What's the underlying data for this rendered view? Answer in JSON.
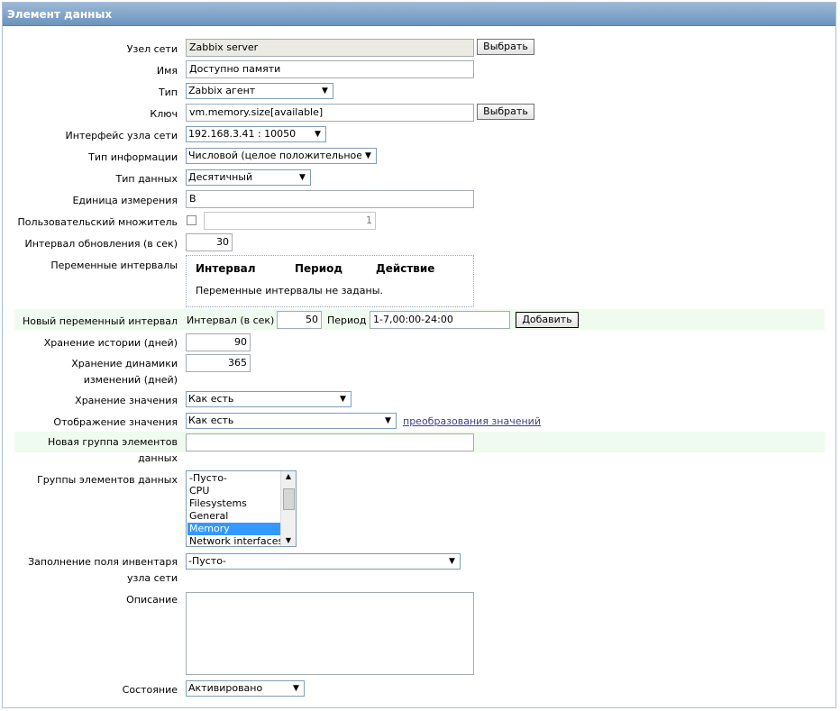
{
  "window": {
    "title": "Элемент данных"
  },
  "form": {
    "host": {
      "label": "Узел сети",
      "value": "Zabbix server",
      "button": "Выбрать"
    },
    "name": {
      "label": "Имя",
      "value": "Доступно памяти"
    },
    "type": {
      "label": "Тип",
      "value": "Zabbix агент"
    },
    "key": {
      "label": "Ключ",
      "value": "vm.memory.size[available]",
      "button": "Выбрать"
    },
    "interface": {
      "label": "Интерфейс узла сети",
      "value": "192.168.3.41 : 10050"
    },
    "info_type": {
      "label": "Тип информации",
      "value": "Числовой (целое положительное)"
    },
    "data_type": {
      "label": "Тип данных",
      "value": "Десятичный"
    },
    "units": {
      "label": "Единица измерения",
      "value": "B"
    },
    "multiplier": {
      "label": "Пользовательский множитель",
      "checked": false,
      "value": "1"
    },
    "update_interval": {
      "label": "Интервал обновления (в сек)",
      "value": "30"
    },
    "flex_intervals": {
      "label": "Переменные интервалы",
      "columns": [
        "Интервал",
        "Период",
        "Действие"
      ],
      "empty_text": "Переменные интервалы не заданы."
    },
    "new_flex": {
      "label": "Новый переменный интервал",
      "interval_label": "Интервал (в сек)",
      "interval_value": "50",
      "period_label": "Период",
      "period_value": "1-7,00:00-24:00",
      "add_button": "Добавить"
    },
    "history": {
      "label": "Хранение истории (дней)",
      "value": "90"
    },
    "trends": {
      "label_line1": "Хранение динамики",
      "label_line2": "изменений (дней)",
      "value": "365"
    },
    "store_value": {
      "label": "Хранение значения",
      "value": "Как есть"
    },
    "show_value": {
      "label": "Отображение значения",
      "value": "Как есть",
      "link": "преобразования значений"
    },
    "new_group": {
      "label_line1": "Новая группа элементов",
      "label_line2": "данных",
      "value": ""
    },
    "groups": {
      "label": "Группы элементов данных",
      "options": [
        "-Пусто-",
        "CPU",
        "Filesystems",
        "General",
        "Memory",
        "Network interfaces"
      ],
      "selected": "Memory"
    },
    "inventory": {
      "label_line1": "Заполнение поля инвентаря",
      "label_line2": "узла сети",
      "value": "-Пусто-"
    },
    "description": {
      "label": "Описание",
      "value": ""
    },
    "status": {
      "label": "Состояние",
      "value": "Активировано"
    }
  },
  "colors": {
    "title_bar": "#7ea1c8",
    "new_row_bg": "#eefbee",
    "selected": "#3399ff",
    "link": "#3d3d8f"
  }
}
